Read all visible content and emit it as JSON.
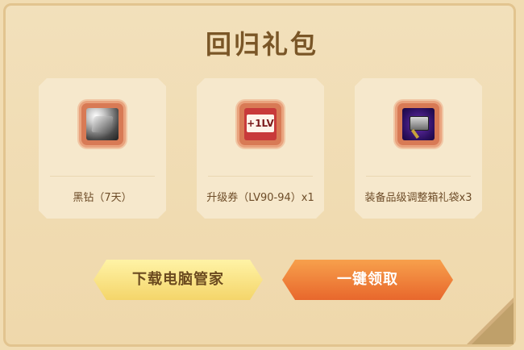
{
  "title": "回归礼包",
  "items": [
    {
      "label": "黑钻（7天）",
      "icon": "black-diamond-icon"
    },
    {
      "label": "升级券（LV90-94）x1",
      "icon": "level-up-ticket-icon",
      "badge": "+1LV"
    },
    {
      "label": "装备品级调整箱礼袋x3",
      "icon": "equipment-grade-box-icon"
    }
  ],
  "buttons": {
    "download": "下载电脑管家",
    "claim": "一键领取"
  },
  "colors": {
    "background": "#f1dcb2",
    "title": "#7a5627",
    "claim_button": "#e8672c",
    "download_button": "#f4d56a"
  }
}
